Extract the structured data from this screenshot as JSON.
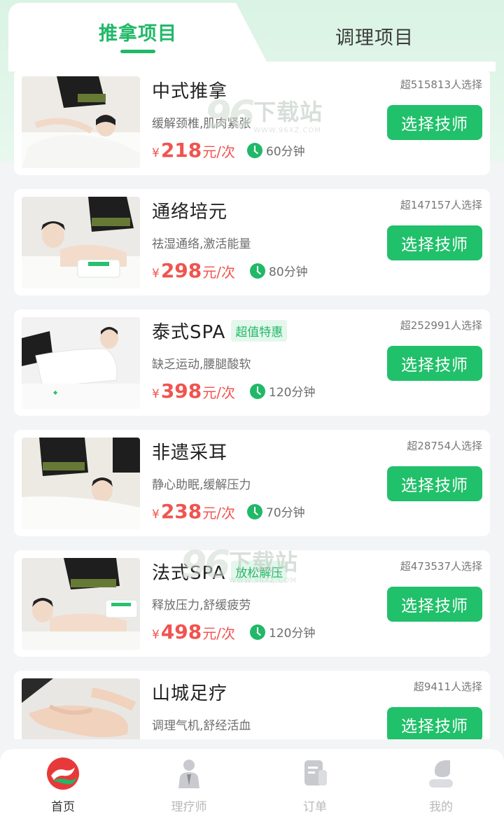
{
  "tabs": {
    "active": "推拿项目",
    "inactive": "调理项目"
  },
  "services": [
    {
      "name": "中式推拿",
      "tag": "",
      "choice": "超515813人选择",
      "desc": "缓解颈椎,肌肉紧张",
      "yen": "¥",
      "price": "218",
      "unit": "元/次",
      "duration": "60分钟",
      "button": "选择技师"
    },
    {
      "name": "通络培元",
      "tag": "",
      "choice": "超147157人选择",
      "desc": "祛湿通络,激活能量",
      "yen": "¥",
      "price": "298",
      "unit": "元/次",
      "duration": "80分钟",
      "button": "选择技师"
    },
    {
      "name": "泰式SPA",
      "tag": "超值特惠",
      "choice": "超252991人选择",
      "desc": "缺乏运动,腰腿酸软",
      "yen": "¥",
      "price": "398",
      "unit": "元/次",
      "duration": "120分钟",
      "button": "选择技师"
    },
    {
      "name": "非遗采耳",
      "tag": "",
      "choice": "超28754人选择",
      "desc": "静心助眠,缓解压力",
      "yen": "¥",
      "price": "238",
      "unit": "元/次",
      "duration": "70分钟",
      "button": "选择技师"
    },
    {
      "name": "法式SPA",
      "tag": "放松解压",
      "choice": "超473537人选择",
      "desc": "释放压力,舒缓疲劳",
      "yen": "¥",
      "price": "498",
      "unit": "元/次",
      "duration": "120分钟",
      "button": "选择技师"
    },
    {
      "name": "山城足疗",
      "tag": "",
      "choice": "超9411人选择",
      "desc": "调理气机,舒经活血",
      "yen": "¥",
      "price": "",
      "unit": "",
      "duration": "",
      "button": "选择技师"
    }
  ],
  "watermark": {
    "logo": "96",
    "text": "下载站",
    "url": "WWW.96XZ.COM"
  },
  "nav": {
    "items": [
      {
        "label": "首页",
        "icon": "home-logo-icon",
        "active": true
      },
      {
        "label": "理疗师",
        "icon": "therapist-icon",
        "active": false
      },
      {
        "label": "订单",
        "icon": "order-icon",
        "active": false
      },
      {
        "label": "我的",
        "icon": "profile-icon",
        "active": false
      }
    ]
  },
  "colors": {
    "accent": "#21b868",
    "button": "#21c06a",
    "price": "#f0544f"
  }
}
